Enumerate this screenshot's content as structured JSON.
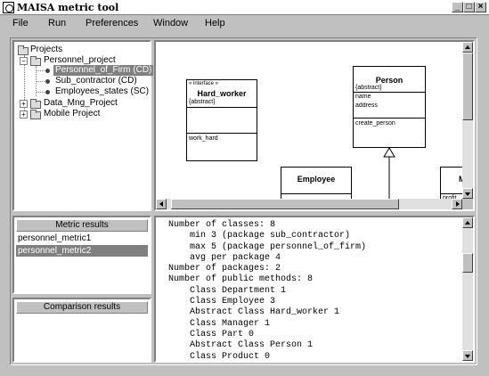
{
  "window": {
    "title": "MAISA metric tool",
    "controls": [
      "_",
      "□",
      "×"
    ]
  },
  "menu": {
    "file": "File",
    "run": "Run",
    "preferences": "Preferences",
    "window": "Window",
    "help": "Help"
  },
  "tree": {
    "root": "Projects",
    "items": [
      {
        "label": "Personnel_project",
        "expander": "−"
      },
      {
        "label": "Personnel_of_Firm (CD)",
        "selected": true
      },
      {
        "label": "Sub_contractor (CD)"
      },
      {
        "label": "Employees_states (SC)"
      },
      {
        "label": "Data_Mng_Project",
        "expander": "+"
      },
      {
        "label": "Mobile Project",
        "expander": "+"
      }
    ]
  },
  "diagram": {
    "classes": [
      {
        "stereotype": "« interface »",
        "name": "Hard_worker",
        "tag": "{abstract}",
        "attributes": [],
        "operations": [
          "work_hard"
        ]
      },
      {
        "name": "Person",
        "tag": "{abstract}",
        "attributes": [
          "name",
          "address"
        ],
        "operations": [
          "create_person"
        ]
      },
      {
        "name": "Employee"
      },
      {
        "name": "M",
        "operations": [
          "profit"
        ]
      }
    ]
  },
  "metric_results": {
    "header": "Metric results",
    "items": [
      {
        "label": "personnel_metric1",
        "selected": false
      },
      {
        "label": "personnel_metric2",
        "selected": true
      }
    ]
  },
  "comparison_results": {
    "header": "Comparison results"
  },
  "results_text": [
    "Number of classes: 8",
    "    min 3 (package sub_contractor)",
    "    max 5 (package personnel_of_firm)",
    "    avg per package 4",
    "Number of packages: 2",
    "Number of public methods: 8",
    "    Class Department 1",
    "    Class Employee 3",
    "    Abstract Class Hard_worker 1",
    "    Class Manager 1",
    "    Class Part 0",
    "    Abstract Class Person 1",
    "    Class Product 0"
  ]
}
